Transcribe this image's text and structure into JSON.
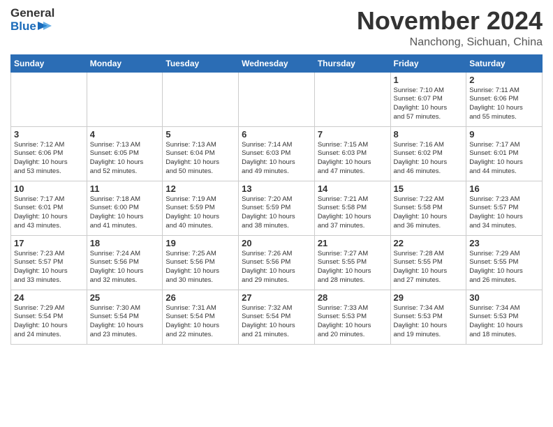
{
  "header": {
    "logo_line1": "General",
    "logo_line2": "Blue",
    "month": "November 2024",
    "location": "Nanchong, Sichuan, China"
  },
  "weekdays": [
    "Sunday",
    "Monday",
    "Tuesday",
    "Wednesday",
    "Thursday",
    "Friday",
    "Saturday"
  ],
  "weeks": [
    [
      {
        "day": "",
        "info": ""
      },
      {
        "day": "",
        "info": ""
      },
      {
        "day": "",
        "info": ""
      },
      {
        "day": "",
        "info": ""
      },
      {
        "day": "",
        "info": ""
      },
      {
        "day": "1",
        "info": "Sunrise: 7:10 AM\nSunset: 6:07 PM\nDaylight: 10 hours\nand 57 minutes."
      },
      {
        "day": "2",
        "info": "Sunrise: 7:11 AM\nSunset: 6:06 PM\nDaylight: 10 hours\nand 55 minutes."
      }
    ],
    [
      {
        "day": "3",
        "info": "Sunrise: 7:12 AM\nSunset: 6:06 PM\nDaylight: 10 hours\nand 53 minutes."
      },
      {
        "day": "4",
        "info": "Sunrise: 7:13 AM\nSunset: 6:05 PM\nDaylight: 10 hours\nand 52 minutes."
      },
      {
        "day": "5",
        "info": "Sunrise: 7:13 AM\nSunset: 6:04 PM\nDaylight: 10 hours\nand 50 minutes."
      },
      {
        "day": "6",
        "info": "Sunrise: 7:14 AM\nSunset: 6:03 PM\nDaylight: 10 hours\nand 49 minutes."
      },
      {
        "day": "7",
        "info": "Sunrise: 7:15 AM\nSunset: 6:03 PM\nDaylight: 10 hours\nand 47 minutes."
      },
      {
        "day": "8",
        "info": "Sunrise: 7:16 AM\nSunset: 6:02 PM\nDaylight: 10 hours\nand 46 minutes."
      },
      {
        "day": "9",
        "info": "Sunrise: 7:17 AM\nSunset: 6:01 PM\nDaylight: 10 hours\nand 44 minutes."
      }
    ],
    [
      {
        "day": "10",
        "info": "Sunrise: 7:17 AM\nSunset: 6:01 PM\nDaylight: 10 hours\nand 43 minutes."
      },
      {
        "day": "11",
        "info": "Sunrise: 7:18 AM\nSunset: 6:00 PM\nDaylight: 10 hours\nand 41 minutes."
      },
      {
        "day": "12",
        "info": "Sunrise: 7:19 AM\nSunset: 5:59 PM\nDaylight: 10 hours\nand 40 minutes."
      },
      {
        "day": "13",
        "info": "Sunrise: 7:20 AM\nSunset: 5:59 PM\nDaylight: 10 hours\nand 38 minutes."
      },
      {
        "day": "14",
        "info": "Sunrise: 7:21 AM\nSunset: 5:58 PM\nDaylight: 10 hours\nand 37 minutes."
      },
      {
        "day": "15",
        "info": "Sunrise: 7:22 AM\nSunset: 5:58 PM\nDaylight: 10 hours\nand 36 minutes."
      },
      {
        "day": "16",
        "info": "Sunrise: 7:23 AM\nSunset: 5:57 PM\nDaylight: 10 hours\nand 34 minutes."
      }
    ],
    [
      {
        "day": "17",
        "info": "Sunrise: 7:23 AM\nSunset: 5:57 PM\nDaylight: 10 hours\nand 33 minutes."
      },
      {
        "day": "18",
        "info": "Sunrise: 7:24 AM\nSunset: 5:56 PM\nDaylight: 10 hours\nand 32 minutes."
      },
      {
        "day": "19",
        "info": "Sunrise: 7:25 AM\nSunset: 5:56 PM\nDaylight: 10 hours\nand 30 minutes."
      },
      {
        "day": "20",
        "info": "Sunrise: 7:26 AM\nSunset: 5:56 PM\nDaylight: 10 hours\nand 29 minutes."
      },
      {
        "day": "21",
        "info": "Sunrise: 7:27 AM\nSunset: 5:55 PM\nDaylight: 10 hours\nand 28 minutes."
      },
      {
        "day": "22",
        "info": "Sunrise: 7:28 AM\nSunset: 5:55 PM\nDaylight: 10 hours\nand 27 minutes."
      },
      {
        "day": "23",
        "info": "Sunrise: 7:29 AM\nSunset: 5:55 PM\nDaylight: 10 hours\nand 26 minutes."
      }
    ],
    [
      {
        "day": "24",
        "info": "Sunrise: 7:29 AM\nSunset: 5:54 PM\nDaylight: 10 hours\nand 24 minutes."
      },
      {
        "day": "25",
        "info": "Sunrise: 7:30 AM\nSunset: 5:54 PM\nDaylight: 10 hours\nand 23 minutes."
      },
      {
        "day": "26",
        "info": "Sunrise: 7:31 AM\nSunset: 5:54 PM\nDaylight: 10 hours\nand 22 minutes."
      },
      {
        "day": "27",
        "info": "Sunrise: 7:32 AM\nSunset: 5:54 PM\nDaylight: 10 hours\nand 21 minutes."
      },
      {
        "day": "28",
        "info": "Sunrise: 7:33 AM\nSunset: 5:53 PM\nDaylight: 10 hours\nand 20 minutes."
      },
      {
        "day": "29",
        "info": "Sunrise: 7:34 AM\nSunset: 5:53 PM\nDaylight: 10 hours\nand 19 minutes."
      },
      {
        "day": "30",
        "info": "Sunrise: 7:34 AM\nSunset: 5:53 PM\nDaylight: 10 hours\nand 18 minutes."
      }
    ]
  ]
}
